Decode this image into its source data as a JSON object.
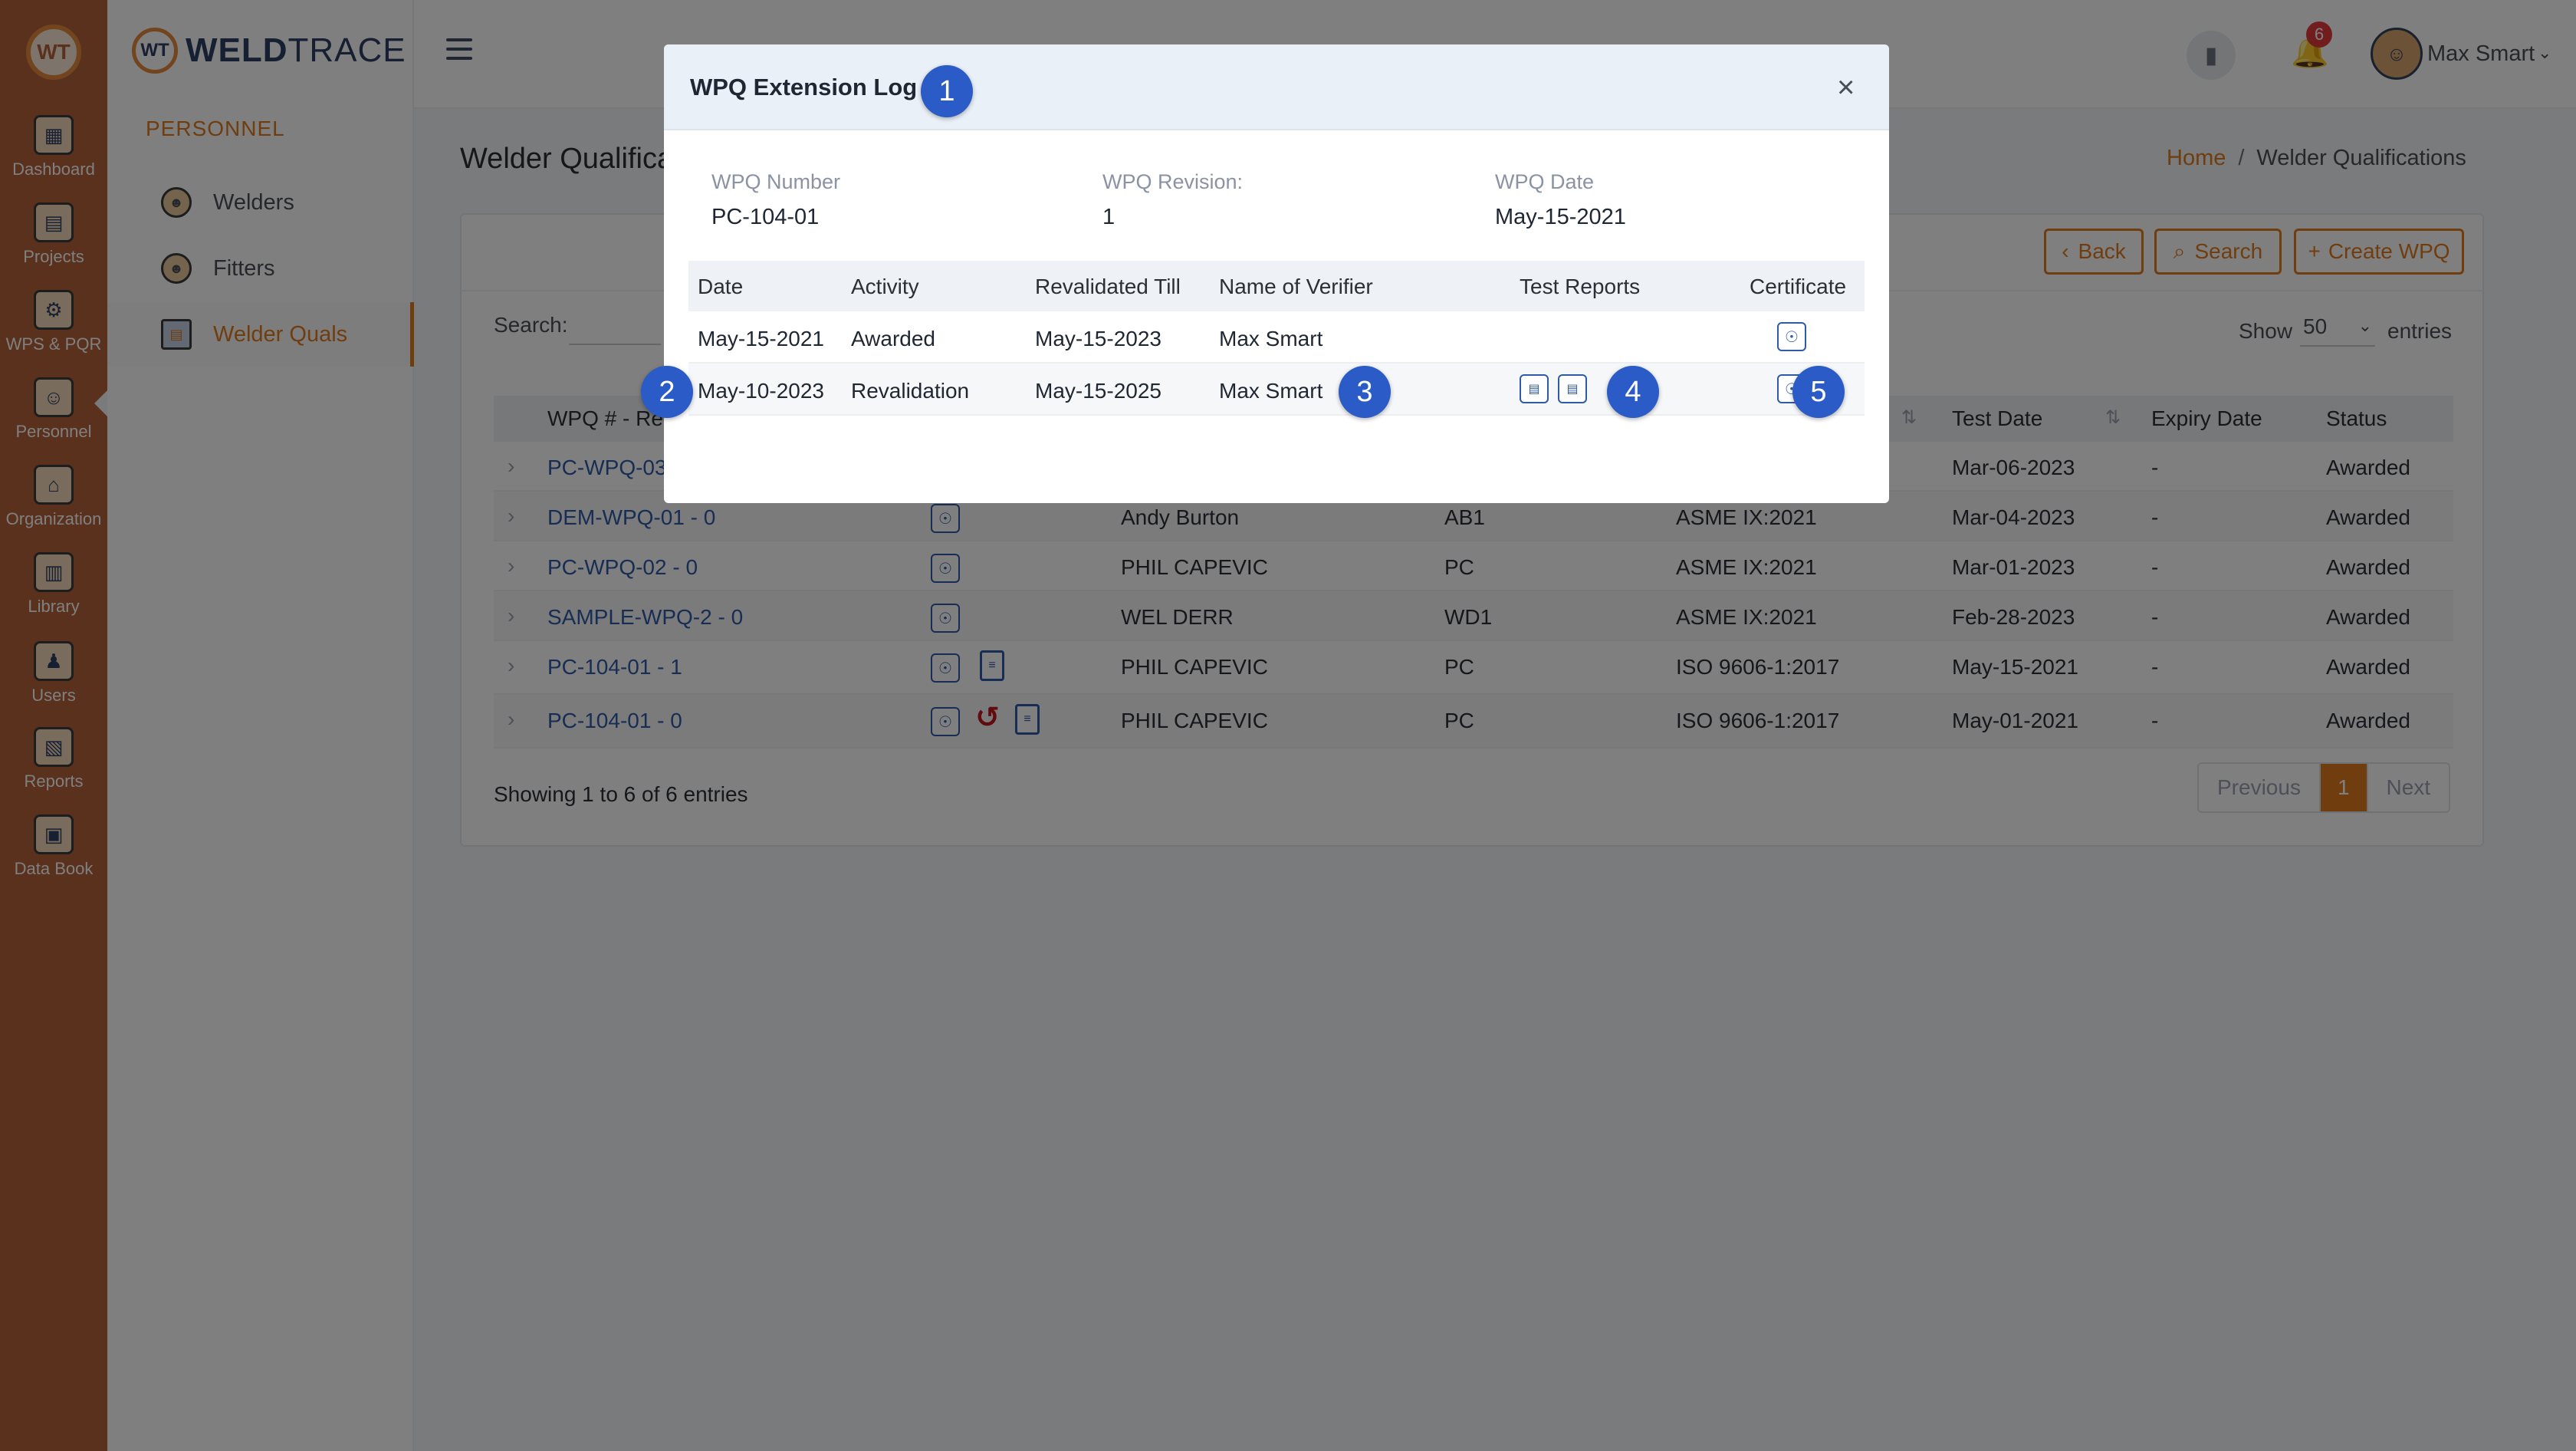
{
  "rail": {
    "items": [
      {
        "label": "Dashboard",
        "icon": "dashboard-icon"
      },
      {
        "label": "Projects",
        "icon": "projects-icon"
      },
      {
        "label": "WPS & PQR",
        "icon": "wps-pqr-icon"
      },
      {
        "label": "Personnel",
        "icon": "personnel-icon",
        "active": true
      },
      {
        "label": "Organization",
        "icon": "organization-icon"
      },
      {
        "label": "Library",
        "icon": "library-icon"
      },
      {
        "label": "Users",
        "icon": "users-icon"
      },
      {
        "label": "Reports",
        "icon": "reports-icon"
      },
      {
        "label": "Data Book",
        "icon": "data-book-icon"
      }
    ]
  },
  "brand": {
    "mark": "WT",
    "name_bold": "WELD",
    "name_light": "TRACE"
  },
  "sidebar": {
    "section": "PERSONNEL",
    "items": [
      {
        "label": "Welders"
      },
      {
        "label": "Fitters"
      },
      {
        "label": "Welder Quals",
        "active": true
      }
    ]
  },
  "topbar": {
    "notifications": "6",
    "user": "Max Smart"
  },
  "page": {
    "title": "Welder Qualifica",
    "breadcrumb_home": "Home",
    "breadcrumb_sep": "/",
    "breadcrumb_current": "Welder Qualifications"
  },
  "toolbar": {
    "back": "Back",
    "search": "Search",
    "create": "Create WPQ"
  },
  "filters": {
    "search_label": "Search:",
    "show_label": "Show",
    "show_value": "50",
    "entries_label": "entries"
  },
  "table": {
    "headers": {
      "wpq": "WPQ # - Rev",
      "test_date": "Test Date",
      "expiry": "Expiry Date",
      "status": "Status"
    },
    "rows": [
      {
        "wpq": "PC-WPQ-03",
        "welder": "",
        "code": "",
        "std": "",
        "test_date": "Mar-06-2023",
        "expiry": "-",
        "status": "Awarded"
      },
      {
        "wpq": "DEM-WPQ-01 - 0",
        "welder": "Andy Burton",
        "code": "AB1",
        "std": "ASME IX:2021",
        "test_date": "Mar-04-2023",
        "expiry": "-",
        "status": "Awarded"
      },
      {
        "wpq": "PC-WPQ-02 - 0",
        "welder": "PHIL CAPEVIC",
        "code": "PC",
        "std": "ASME IX:2021",
        "test_date": "Mar-01-2023",
        "expiry": "-",
        "status": "Awarded"
      },
      {
        "wpq": "SAMPLE-WPQ-2 - 0",
        "welder": "WEL DERR",
        "code": "WD1",
        "std": "ASME IX:2021",
        "test_date": "Feb-28-2023",
        "expiry": "-",
        "status": "Awarded"
      },
      {
        "wpq": "PC-104-01 - 1",
        "welder": "PHIL CAPEVIC",
        "code": "PC",
        "std": "ISO 9606-1:2017",
        "test_date": "May-15-2021",
        "expiry": "-",
        "status": "Awarded"
      },
      {
        "wpq": "PC-104-01 - 0",
        "welder": "PHIL CAPEVIC",
        "code": "PC",
        "std": "ISO 9606-1:2017",
        "test_date": "May-01-2021",
        "expiry": "-",
        "status": "Awarded"
      }
    ],
    "showing": "Showing 1 to 6 of 6 entries"
  },
  "pager": {
    "prev": "Previous",
    "current": "1",
    "next": "Next"
  },
  "modal": {
    "title": "WPQ Extension Log",
    "fields": {
      "number_label": "WPQ Number",
      "number_value": "PC-104-01",
      "revision_label": "WPQ Revision:",
      "revision_value": "1",
      "date_label": "WPQ Date",
      "date_value": "May-15-2021"
    },
    "headers": {
      "date": "Date",
      "activity": "Activity",
      "till": "Revalidated Till",
      "verifier": "Name of Verifier",
      "reports": "Test Reports",
      "certificate": "Certificate"
    },
    "rows": [
      {
        "date": "May-15-2021",
        "activity": "Awarded",
        "till": "May-15-2023",
        "verifier": "Max Smart"
      },
      {
        "date": "May-10-2023",
        "activity": "Revalidation",
        "till": "May-15-2025",
        "verifier": "Max Smart"
      }
    ]
  },
  "markers": [
    "1",
    "2",
    "3",
    "4",
    "5"
  ],
  "colors": {
    "accent": "#e07a1f",
    "rail": "#b4623a",
    "link": "#2e5aa8",
    "marker": "#2a5bc7",
    "history": "#c4161c"
  }
}
